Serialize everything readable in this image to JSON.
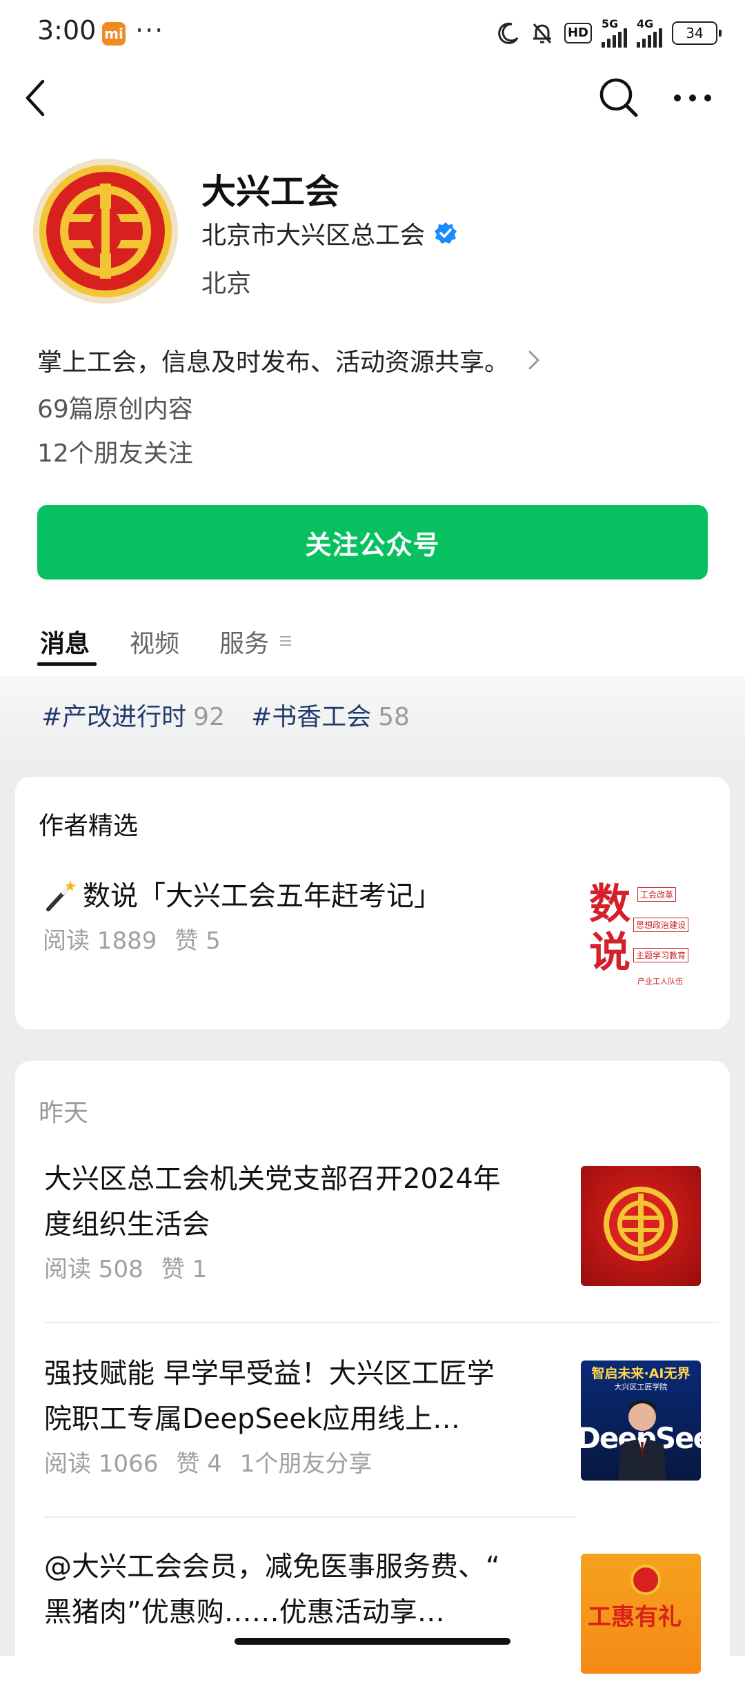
{
  "status_bar": {
    "time": "3:00",
    "mi_badge": "mi",
    "overflow": "···",
    "hd_label": "HD",
    "net1": "5G",
    "net2": "4G",
    "battery": "34"
  },
  "profile": {
    "name": "大兴工会",
    "org": "北京市大兴区总工会",
    "city": "北京",
    "description": "掌上工会，信息及时发布、活动资源共享。",
    "original_count": "69篇原创内容",
    "friends_following": "12个朋友关注",
    "follow_button": "关注公众号"
  },
  "tabs": [
    {
      "label": "消息",
      "active": true
    },
    {
      "label": "视频",
      "active": false
    },
    {
      "label": "服务",
      "active": false
    }
  ],
  "tags": [
    {
      "name": "#产改进行时",
      "count": "92"
    },
    {
      "name": "#书香工会",
      "count": "58"
    }
  ],
  "featured": {
    "heading": "作者精选",
    "article": {
      "title": "数说「大兴工会五年赶考记」",
      "reads": "阅读 1889",
      "likes": "赞 5",
      "thumb_big_text": "数说",
      "thumb_items": [
        "工会改革",
        "思想政治建设",
        "主题学习教育",
        "产业工人队伍"
      ]
    }
  },
  "feed": {
    "date_label": "昨天",
    "articles": [
      {
        "title_line1": "大兴区总工会机关党支部召开2024年",
        "title_line2": "度组织生活会",
        "reads": "阅读 508",
        "likes": "赞 1",
        "shares": ""
      },
      {
        "title_line1": "强技赋能 早学早受益！大兴区工匠学",
        "title_line2": "院职工专属DeepSeek应用线上…",
        "reads": "阅读 1066",
        "likes": "赞 4",
        "shares": "1个朋友分享",
        "thumb_banner": "智启未来·AI无界",
        "thumb_sub": "大兴区工匠学院",
        "thumb_word": "DeepSeek"
      },
      {
        "title_line1": "@大兴工会会员，减免医事服务费、“",
        "title_line2": "黑猪肉”优惠购……优惠活动享…",
        "thumb_text": "工惠有礼"
      }
    ]
  },
  "colors": {
    "brand_green": "#07c160",
    "tag_blue": "#1f3c6e",
    "verified_blue": "#1a8cff",
    "emblem_red": "#d8211f",
    "emblem_gold": "#f6c531"
  }
}
